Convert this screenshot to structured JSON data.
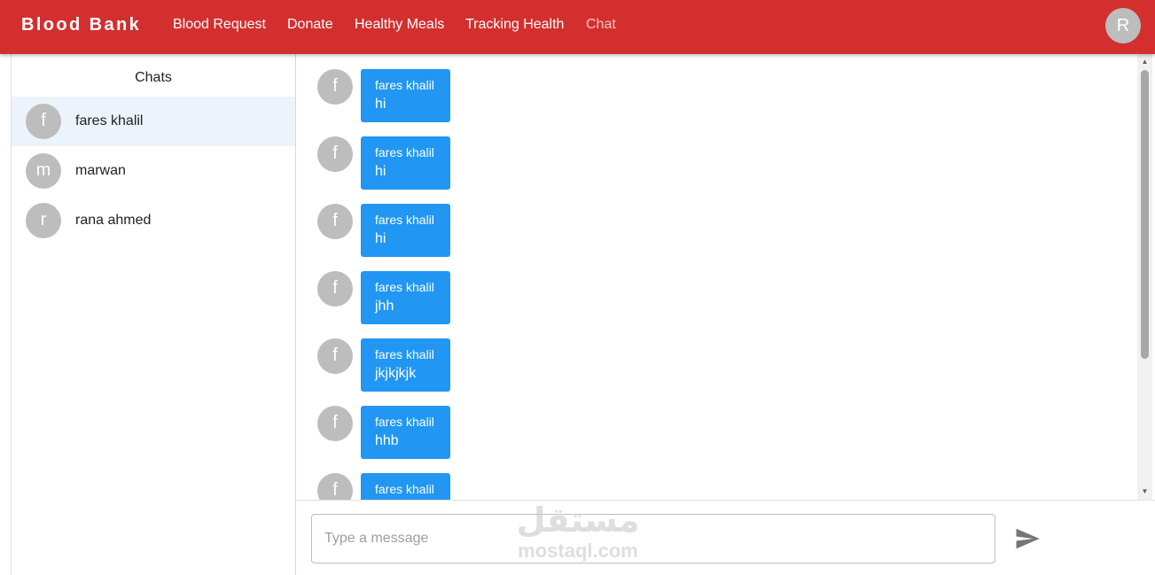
{
  "navbar": {
    "brand": "Blood Bank",
    "links": [
      "Blood Request",
      "Donate",
      "Healthy Meals",
      "Tracking Health",
      "Chat"
    ],
    "active_link": "Chat",
    "user_initial": "R",
    "color": "#d32f2f"
  },
  "sidebar": {
    "title": "Chats",
    "contacts": [
      {
        "initial": "f",
        "name": "fares khalil",
        "selected": true
      },
      {
        "initial": "m",
        "name": "marwan",
        "selected": false
      },
      {
        "initial": "r",
        "name": "rana ahmed",
        "selected": false
      }
    ]
  },
  "chat": {
    "messages": [
      {
        "initial": "f",
        "sender": "fares khalil",
        "text": "hi"
      },
      {
        "initial": "f",
        "sender": "fares khalil",
        "text": "hi"
      },
      {
        "initial": "f",
        "sender": "fares khalil",
        "text": "hi"
      },
      {
        "initial": "f",
        "sender": "fares khalil",
        "text": "jhh"
      },
      {
        "initial": "f",
        "sender": "fares khalil",
        "text": "jkjkjkjk"
      },
      {
        "initial": "f",
        "sender": "fares khalil",
        "text": "hhb"
      },
      {
        "initial": "f",
        "sender": "fares khalil",
        "text": ""
      }
    ],
    "bubble_color": "#2196f3",
    "input": {
      "value": "",
      "placeholder": "Type a message"
    },
    "send_icon": "send-icon"
  },
  "watermark": {
    "arabic": "مستقل",
    "latin": "mostaql.com"
  }
}
